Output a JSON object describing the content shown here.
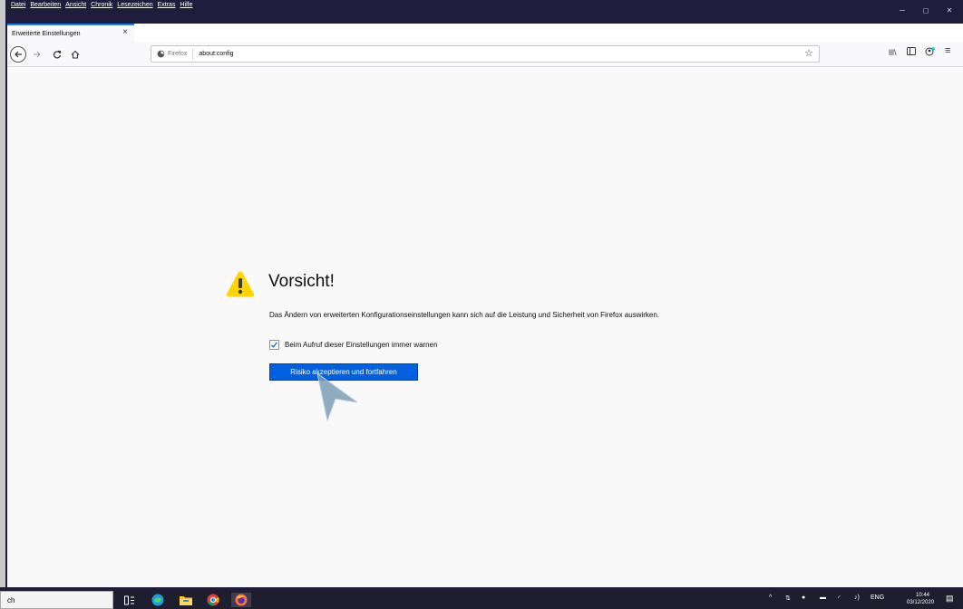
{
  "menubar": {
    "items": [
      "Datei",
      "Bearbeiten",
      "Ansicht",
      "Chronik",
      "Lesezeichen",
      "Extras",
      "Hilfe"
    ]
  },
  "window_controls": {
    "minimize": "–",
    "maximize": "◻",
    "close": "✕"
  },
  "tab": {
    "title": "Erweiterte Einstellungen",
    "close": "×",
    "new_tab": "+"
  },
  "urlbar": {
    "identity": "Firefox",
    "url": "about:config"
  },
  "warning": {
    "title": "Vorsicht!",
    "body": "Das Ändern von erweiterten Konfigurationseinstellungen kann sich auf die Leistung und Sicherheit von Firefox auswirken.",
    "checkbox_label": "Beim Aufruf dieser Einstellungen immer warnen",
    "checkbox_checked": true,
    "button_label": "Risiko akzeptieren und fortfahren"
  },
  "taskbar": {
    "search_text": "ch",
    "language": "ENG",
    "time": "10:44",
    "date": "03/12/2020"
  },
  "colors": {
    "titlebar": "#1f1d3b",
    "accent": "#0060df",
    "warning_yellow": "#ffd400",
    "content_bg": "#f9f9fa"
  }
}
